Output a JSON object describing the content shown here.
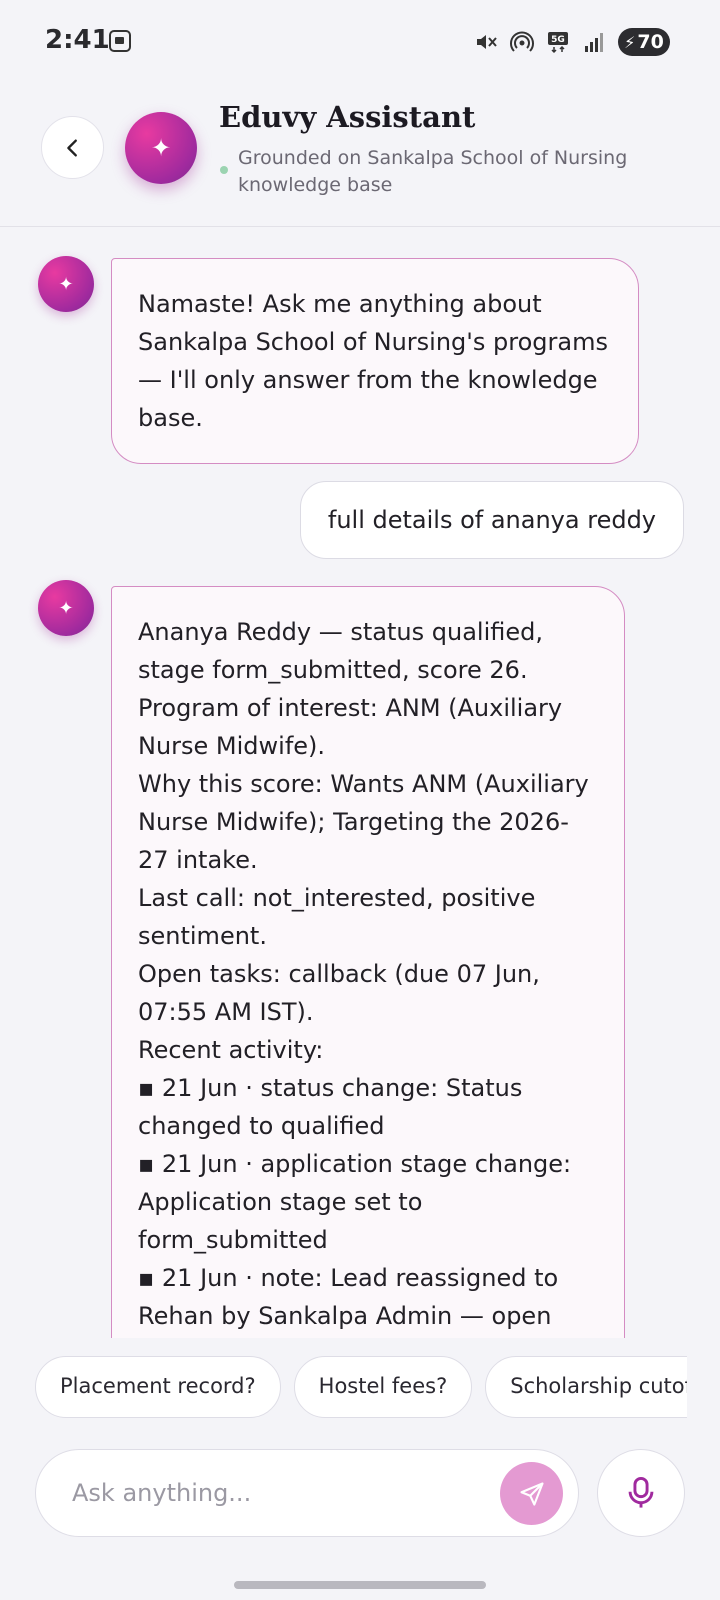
{
  "status_bar": {
    "time": "2:41",
    "battery": "70",
    "network": "5G",
    "icons": [
      "screenshot-icon",
      "mute-icon",
      "hotspot-icon",
      "network-5g-icon",
      "signal-icon",
      "battery-charging-icon"
    ]
  },
  "header": {
    "back_icon": "chevron-left-icon",
    "avatar_icon": "sparkle-icon",
    "title": "Eduvy Assistant",
    "subtitle": "Grounded on Sankalpa School of Nursing knowledge base"
  },
  "messages": [
    {
      "role": "assistant",
      "lines": [
        "Namaste! Ask me anything about Sankalpa School of Nursing's programs — I'll only answer from the knowledge base."
      ]
    },
    {
      "role": "user",
      "lines": [
        "full details of ananya reddy"
      ]
    },
    {
      "role": "assistant",
      "lines": [
        "Ananya Reddy — status qualified, stage form_submitted, score 26.",
        "Program of interest: ANM (Auxiliary Nurse Midwife).",
        "Why this score: Wants ANM (Auxiliary Nurse Midwife); Targeting the 2026-27 intake.",
        "Last call: not_interested, positive sentiment.",
        "Open tasks: callback (due 07 Jun, 07:55 AM IST).",
        "Recent activity:",
        "▪ 21 Jun · status change: Status changed to qualified",
        "▪ 21 Jun · application stage change: Application stage set to form_submitted",
        "▪ 21 Jun · note: Lead reassigned to Rehan by Sankalpa Admin — open"
      ]
    }
  ],
  "quick_replies": [
    "Placement record?",
    "Hostel fees?",
    "Scholarship cutoff?"
  ],
  "composer": {
    "placeholder": "Ask anything...",
    "send_icon": "send-icon",
    "mic_icon": "microphone-icon"
  },
  "colors": {
    "accent": "#c2349e",
    "send_button": "#e49ad2",
    "bubble_border": "#d48cc3",
    "online_dot": "#9bd3b1"
  }
}
